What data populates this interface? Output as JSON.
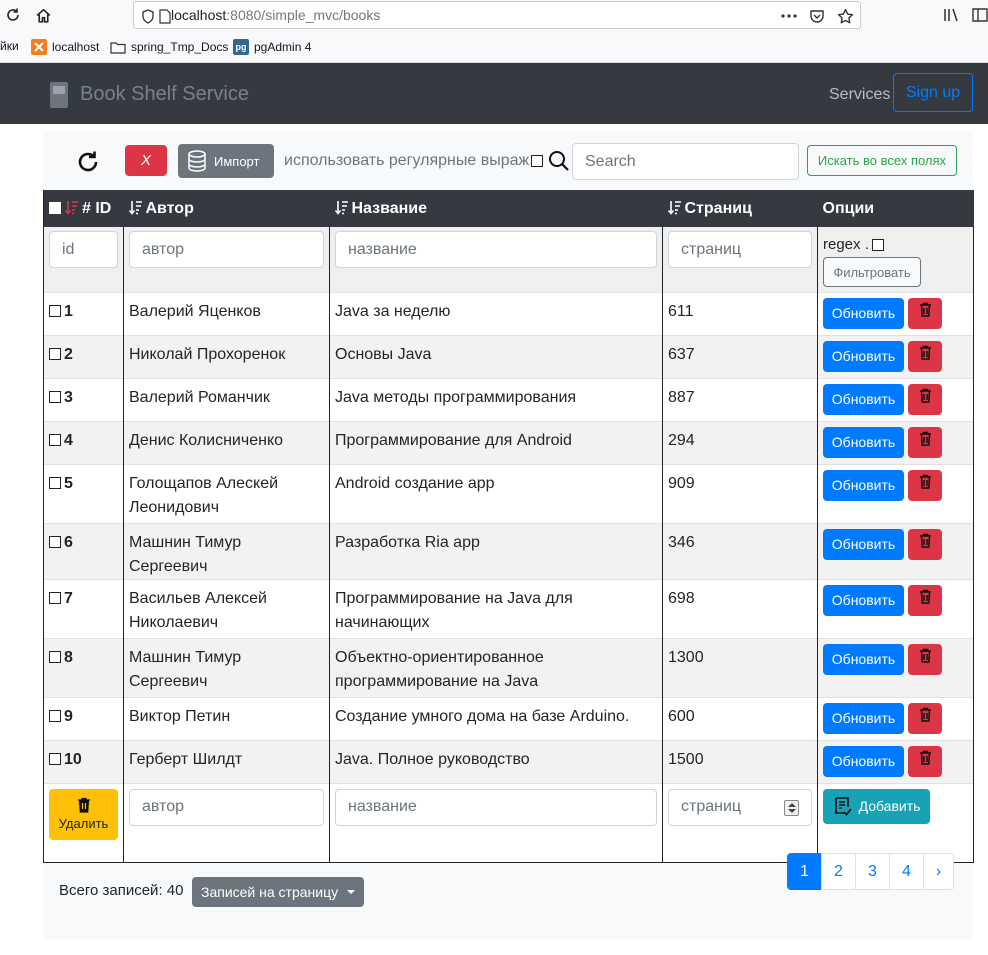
{
  "browser": {
    "url_host": "localhost",
    "url_rest": ":8080/simple_mvc/books",
    "bookmarks": [
      {
        "label": "йки",
        "icon": ""
      },
      {
        "label": "localhost",
        "icon": "xampp-icon"
      },
      {
        "label": "spring_Tmp_Docs",
        "icon": "folder-icon"
      },
      {
        "label": "pgAdmin 4",
        "icon": "pgadmin-icon"
      }
    ]
  },
  "navbar": {
    "brand": "Book Shelf Service",
    "services": "Services",
    "signup": "Sign up"
  },
  "toolbar": {
    "clear": "X",
    "import": "Импорт",
    "regex_label": "использовать регулярные выраж.",
    "search_placeholder": "Search",
    "search_all": "Искать во всех полях"
  },
  "table": {
    "headers": {
      "id": "# ID",
      "author": "Автор",
      "title": "Название",
      "pages": "Страниц",
      "options": "Опции"
    },
    "filter": {
      "id_placeholder": "id",
      "author_placeholder": "автор",
      "title_placeholder": "название",
      "pages_placeholder": "страниц",
      "regex": "regex .",
      "filter_button": "Фильтровать"
    },
    "rows": [
      {
        "id": "1",
        "author": "Валерий Яценков",
        "title": "Java за неделю",
        "pages": "611"
      },
      {
        "id": "2",
        "author": "Николай Прохоренок",
        "title": "Основы Java",
        "pages": "637"
      },
      {
        "id": "3",
        "author": "Валерий Романчик",
        "title": "Java методы программирования",
        "pages": "887"
      },
      {
        "id": "4",
        "author": "Денис Колисниченко",
        "title": "Программирование для Android",
        "pages": "294"
      },
      {
        "id": "5",
        "author": "Голощапов Алескей Леонидович",
        "title": "Android создание app",
        "pages": "909"
      },
      {
        "id": "6",
        "author": "Машнин Тимур Сергеевич",
        "title": "Разработка Ria app",
        "pages": "346"
      },
      {
        "id": "7",
        "author": "Васильев Алексей Николаевич",
        "title": "Программирование на Java для начинающих",
        "pages": "698"
      },
      {
        "id": "8",
        "author": "Машнин Тимур Сергеевич",
        "title": "Объектно-ориентированное программирование на Java",
        "pages": "1300"
      },
      {
        "id": "9",
        "author": "Виктор Петин",
        "title": "Создание умного дома на базе Arduino.",
        "pages": "600"
      },
      {
        "id": "10",
        "author": "Герберт Шилдт",
        "title": "Java. Полное руководство",
        "pages": "1500"
      }
    ],
    "update_label": "Обновить",
    "add_row": {
      "delete_label": "Удалить",
      "author_placeholder": "автор",
      "title_placeholder": "название",
      "pages_placeholder": "страниц",
      "add_label": "Добавить"
    }
  },
  "footer": {
    "total": "Всего записей: 40",
    "per_page": "Записей на страницу",
    "pages": [
      "1",
      "2",
      "3",
      "4"
    ],
    "next": "›",
    "active_page": "1"
  },
  "colors": {
    "primary": "#007bff",
    "danger": "#dc3545",
    "success": "#28a745",
    "warning": "#ffc107",
    "info": "#17a2b8",
    "dark": "#343a40",
    "secondary": "#6c757d"
  }
}
